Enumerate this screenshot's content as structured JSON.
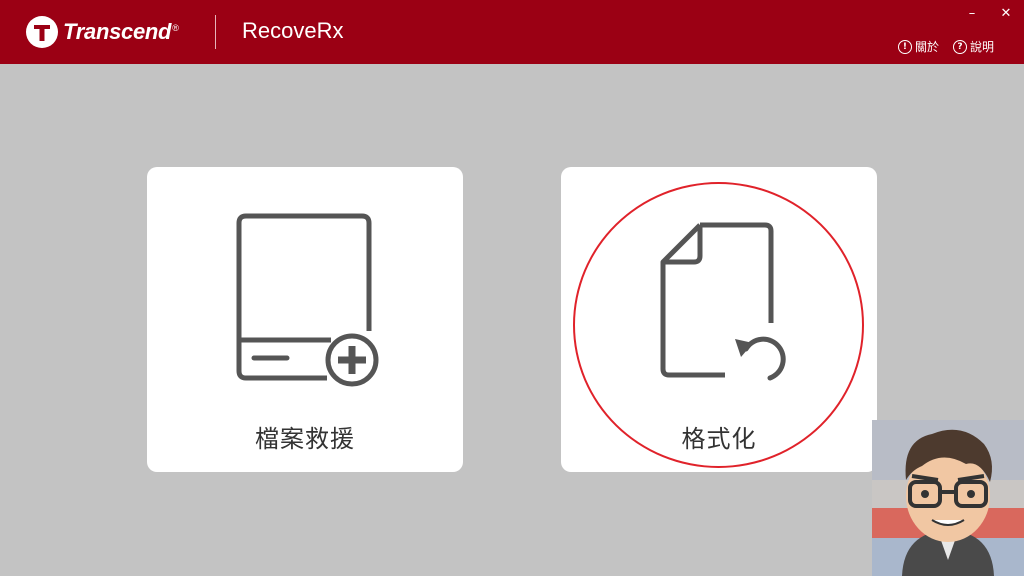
{
  "header": {
    "brand": "Transcend",
    "brand_mark": "®",
    "app_title": "RecoveRx",
    "window_controls": {
      "minimize": "–",
      "close": "✕"
    },
    "links": [
      {
        "icon": "info-circle-icon",
        "label": "關於"
      },
      {
        "icon": "question-circle-icon",
        "label": "說明"
      }
    ]
  },
  "cards": [
    {
      "label": "檔案救援",
      "icon": "drive-plus-icon"
    },
    {
      "label": "格式化",
      "icon": "document-undo-icon"
    }
  ],
  "colors": {
    "header": "#9b0014",
    "background": "#c3c3c3",
    "card": "#ffffff",
    "icon": "#555555",
    "highlight": "#e0222a"
  }
}
